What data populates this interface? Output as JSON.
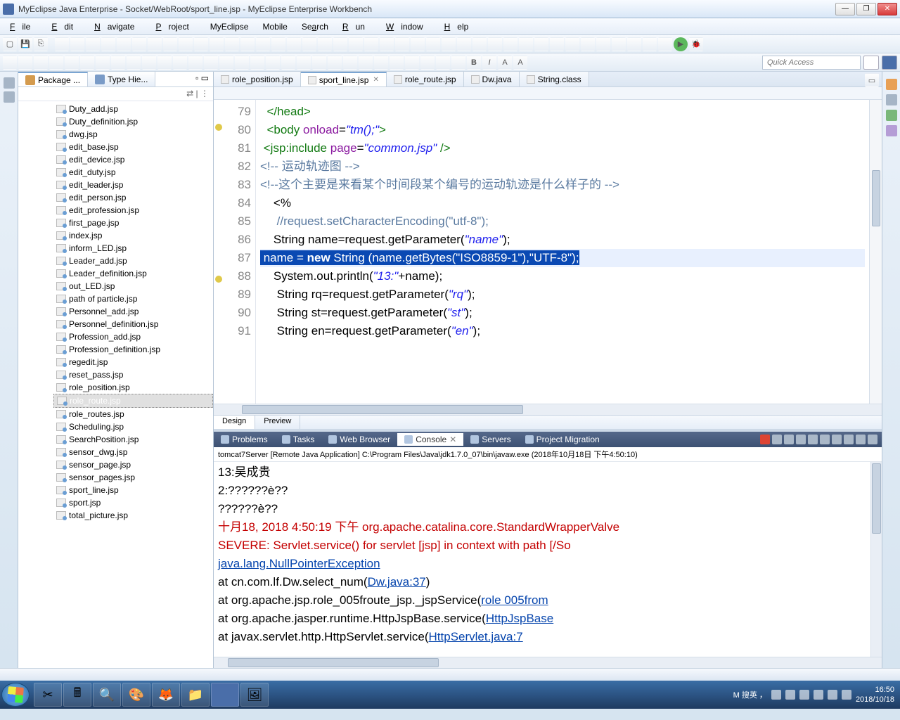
{
  "window": {
    "title": "MyEclipse Java Enterprise - Socket/WebRoot/sport_line.jsp - MyEclipse Enterprise Workbench"
  },
  "menu": {
    "file": "File",
    "edit": "Edit",
    "navigate": "Navigate",
    "project": "Project",
    "myeclipse": "MyEclipse",
    "mobile": "Mobile",
    "search": "Search",
    "run": "Run",
    "window": "Window",
    "help": "Help"
  },
  "toolbar": {
    "quick_access": "Quick Access"
  },
  "explorer": {
    "tab1": "Package ...",
    "tab2": "Type Hie...",
    "files": [
      "Duty_add.jsp",
      "Duty_definition.jsp",
      "dwg.jsp",
      "edit_base.jsp",
      "edit_device.jsp",
      "edit_duty.jsp",
      "edit_leader.jsp",
      "edit_person.jsp",
      "edit_profession.jsp",
      "first_page.jsp",
      "index.jsp",
      "inform_LED.jsp",
      "Leader_add.jsp",
      "Leader_definition.jsp",
      "out_LED.jsp",
      "path of particle.jsp",
      "Personnel_add.jsp",
      "Personnel_definition.jsp",
      "Profession_add.jsp",
      "Profession_definition.jsp",
      "regedit.jsp",
      "reset_pass.jsp",
      "role_position.jsp",
      "role_route.jsp",
      "role_routes.jsp",
      "Scheduling.jsp",
      "SearchPosition.jsp",
      "sensor_dwg.jsp",
      "sensor_page.jsp",
      "sensor_pages.jsp",
      "sport_line.jsp",
      "sport.jsp",
      "total_picture.jsp"
    ],
    "selected": "role_route.jsp"
  },
  "editor": {
    "tabs": [
      "role_position.jsp",
      "sport_line.jsp",
      "role_route.jsp",
      "Dw.java",
      "String.class"
    ],
    "active_tab": "sport_line.jsp",
    "line_start": 79,
    "lines": [
      {
        "n": 79,
        "html": "  <span class='tag'>&lt;/head&gt;</span>"
      },
      {
        "n": 80,
        "html": "  <span class='tag'>&lt;body</span> <span class='attr'>onload</span>=<span class='str'>\"tm();\"</span><span class='tag'>&gt;</span>",
        "mark": true
      },
      {
        "n": 81,
        "html": " <span class='tag'>&lt;jsp:include</span> <span class='attr'>page</span>=<span class='str'>\"common.jsp\"</span> <span class='tag'>/&gt;</span>"
      },
      {
        "n": 82,
        "html": "<span class='cm'>&lt;!-- 运动轨迹图 --&gt;</span>"
      },
      {
        "n": 83,
        "html": "<span class='cm'>&lt;!--这个主要是来看某个时间段某个编号的运动轨迹是什么样子的 --&gt;</span>"
      },
      {
        "n": 84,
        "html": "    <span class='plain'>&lt;%</span>"
      },
      {
        "n": 85,
        "html": "     <span class='cm'>//request.setCharacterEncoding(\"utf-8\");</span>"
      },
      {
        "n": 86,
        "html": "    <span class='plain'>String name=request.getParameter(</span><span class='str'>\"name\"</span><span class='plain'>);</span>"
      },
      {
        "n": 87,
        "hl": true,
        "sel": true,
        "html": "<span class='sel'> name = <span class='kw'>new</span> String (name.getBytes(\"ISO8859-1\"),\"UTF-8\");</span>"
      },
      {
        "n": 88,
        "html": "    <span class='plain'>System.out.println(</span><span class='str'>\"13:\"</span><span class='plain'>+name);</span>",
        "mark": true
      },
      {
        "n": 89,
        "html": "     <span class='plain'>String rq=request.getParameter(</span><span class='str'>\"rq\"</span><span class='plain'>);</span>"
      },
      {
        "n": 90,
        "html": "     <span class='plain'>String st=request.getParameter(</span><span class='str'>\"st\"</span><span class='plain'>);</span>"
      },
      {
        "n": 91,
        "html": "     <span class='plain'>String en=request.getParameter(</span><span class='str'>\"en\"</span><span class='plain'>);</span>"
      }
    ],
    "bottom_tabs": {
      "design": "Design",
      "preview": "Preview"
    }
  },
  "bottom_panel": {
    "tabs": [
      "Problems",
      "Tasks",
      "Web Browser",
      "Console",
      "Servers",
      "Project Migration"
    ],
    "active": "Console",
    "header": "tomcat7Server [Remote Java Application] C:\\Program Files\\Java\\jdk1.7.0_07\\bin\\javaw.exe (2018年10月18日 下午4:50:10)",
    "lines": [
      {
        "t": "13:吴成贵"
      },
      {
        "t": "2:??????è??"
      },
      {
        "t": "??????è??"
      },
      {
        "t": "十月18, 2018 4:50:19 下午 org.apache.catalina.core.StandardWrapperValve",
        "cls": "red"
      },
      {
        "t": "SEVERE: Servlet.service() for servlet [jsp] in context with path [/So",
        "cls": "red"
      },
      {
        "t": "java.lang.NullPointerException",
        "cls": "blue"
      },
      {
        "t": "        at cn.com.lf.Dw.select_num(",
        "link": "Dw.java:37",
        "after": ")"
      },
      {
        "t": "        at org.apache.jsp.role_005froute_jsp._jspService(",
        "link": "role 005from",
        "after": ""
      },
      {
        "t": "        at org.apache.jasper.runtime.HttpJspBase.service(",
        "link": "HttpJspBase",
        "after": ""
      },
      {
        "t": "        at javax.servlet.http.HttpServlet.service(",
        "link": "HttpServlet.java:7",
        "after": ""
      }
    ]
  },
  "taskbar": {
    "ime": "M 搜英 ，",
    "time": "16:50",
    "date": "2018/10/18"
  }
}
